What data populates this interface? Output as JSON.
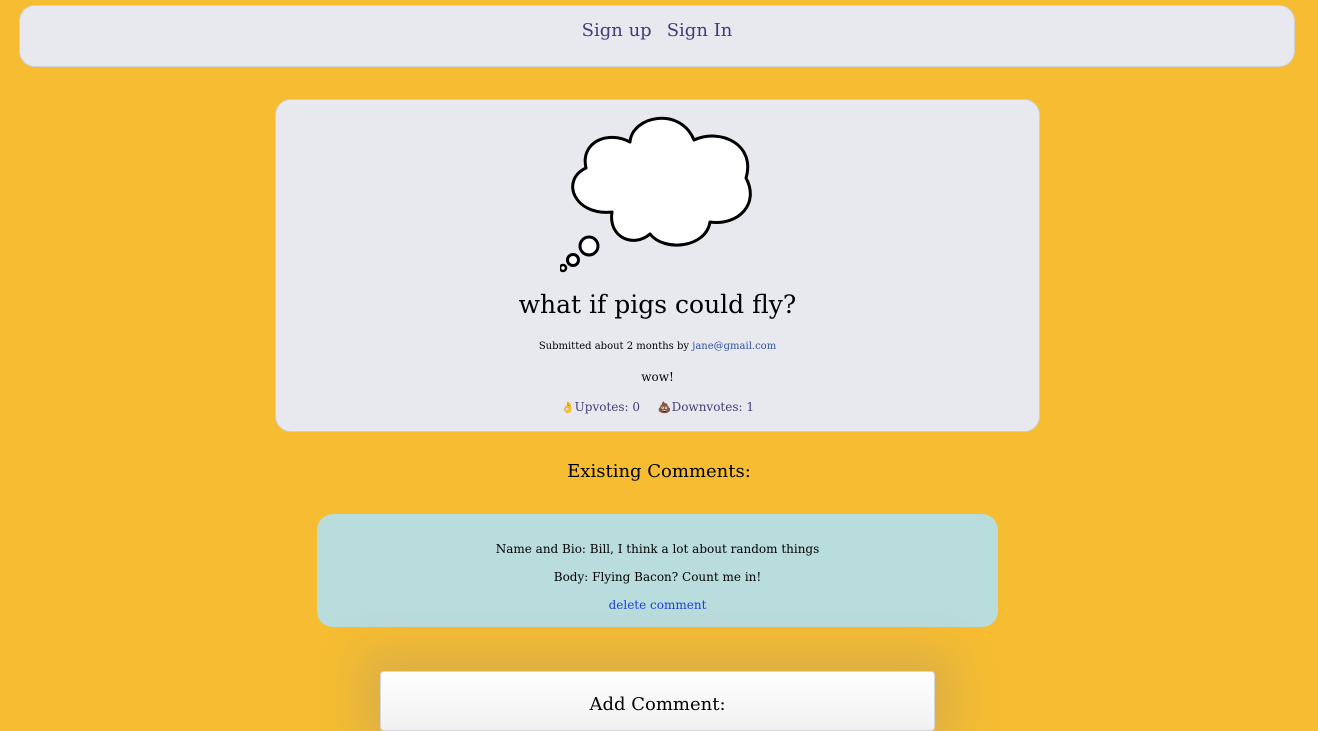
{
  "nav": {
    "signup_label": "Sign up",
    "signin_label": "Sign In"
  },
  "post": {
    "image": "thought-bubble-icon",
    "title": "what if pigs could fly?",
    "submitted_prefix": "Submitted about 2 months by",
    "author_email": "jane@gmail.com",
    "body": "wow!",
    "upvote_icon": "👌",
    "upvote_label": "Upvotes: 0",
    "downvote_icon": "💩",
    "downvote_label": "Downvotes: 1"
  },
  "comments": {
    "heading": "Existing Comments:",
    "items": [
      {
        "name_bio": "Name and Bio: Bill, I think a lot about random things",
        "body": "Body: Flying Bacon? Count me in!",
        "delete_label": "delete comment"
      }
    ]
  },
  "add_comment": {
    "heading": "Add Comment:"
  },
  "colors": {
    "background": "#f6bd32",
    "card": "#e8e9ee",
    "comment_card": "#b9dcdd",
    "nav_link": "#463a7a",
    "link": "#1e3fd8"
  }
}
